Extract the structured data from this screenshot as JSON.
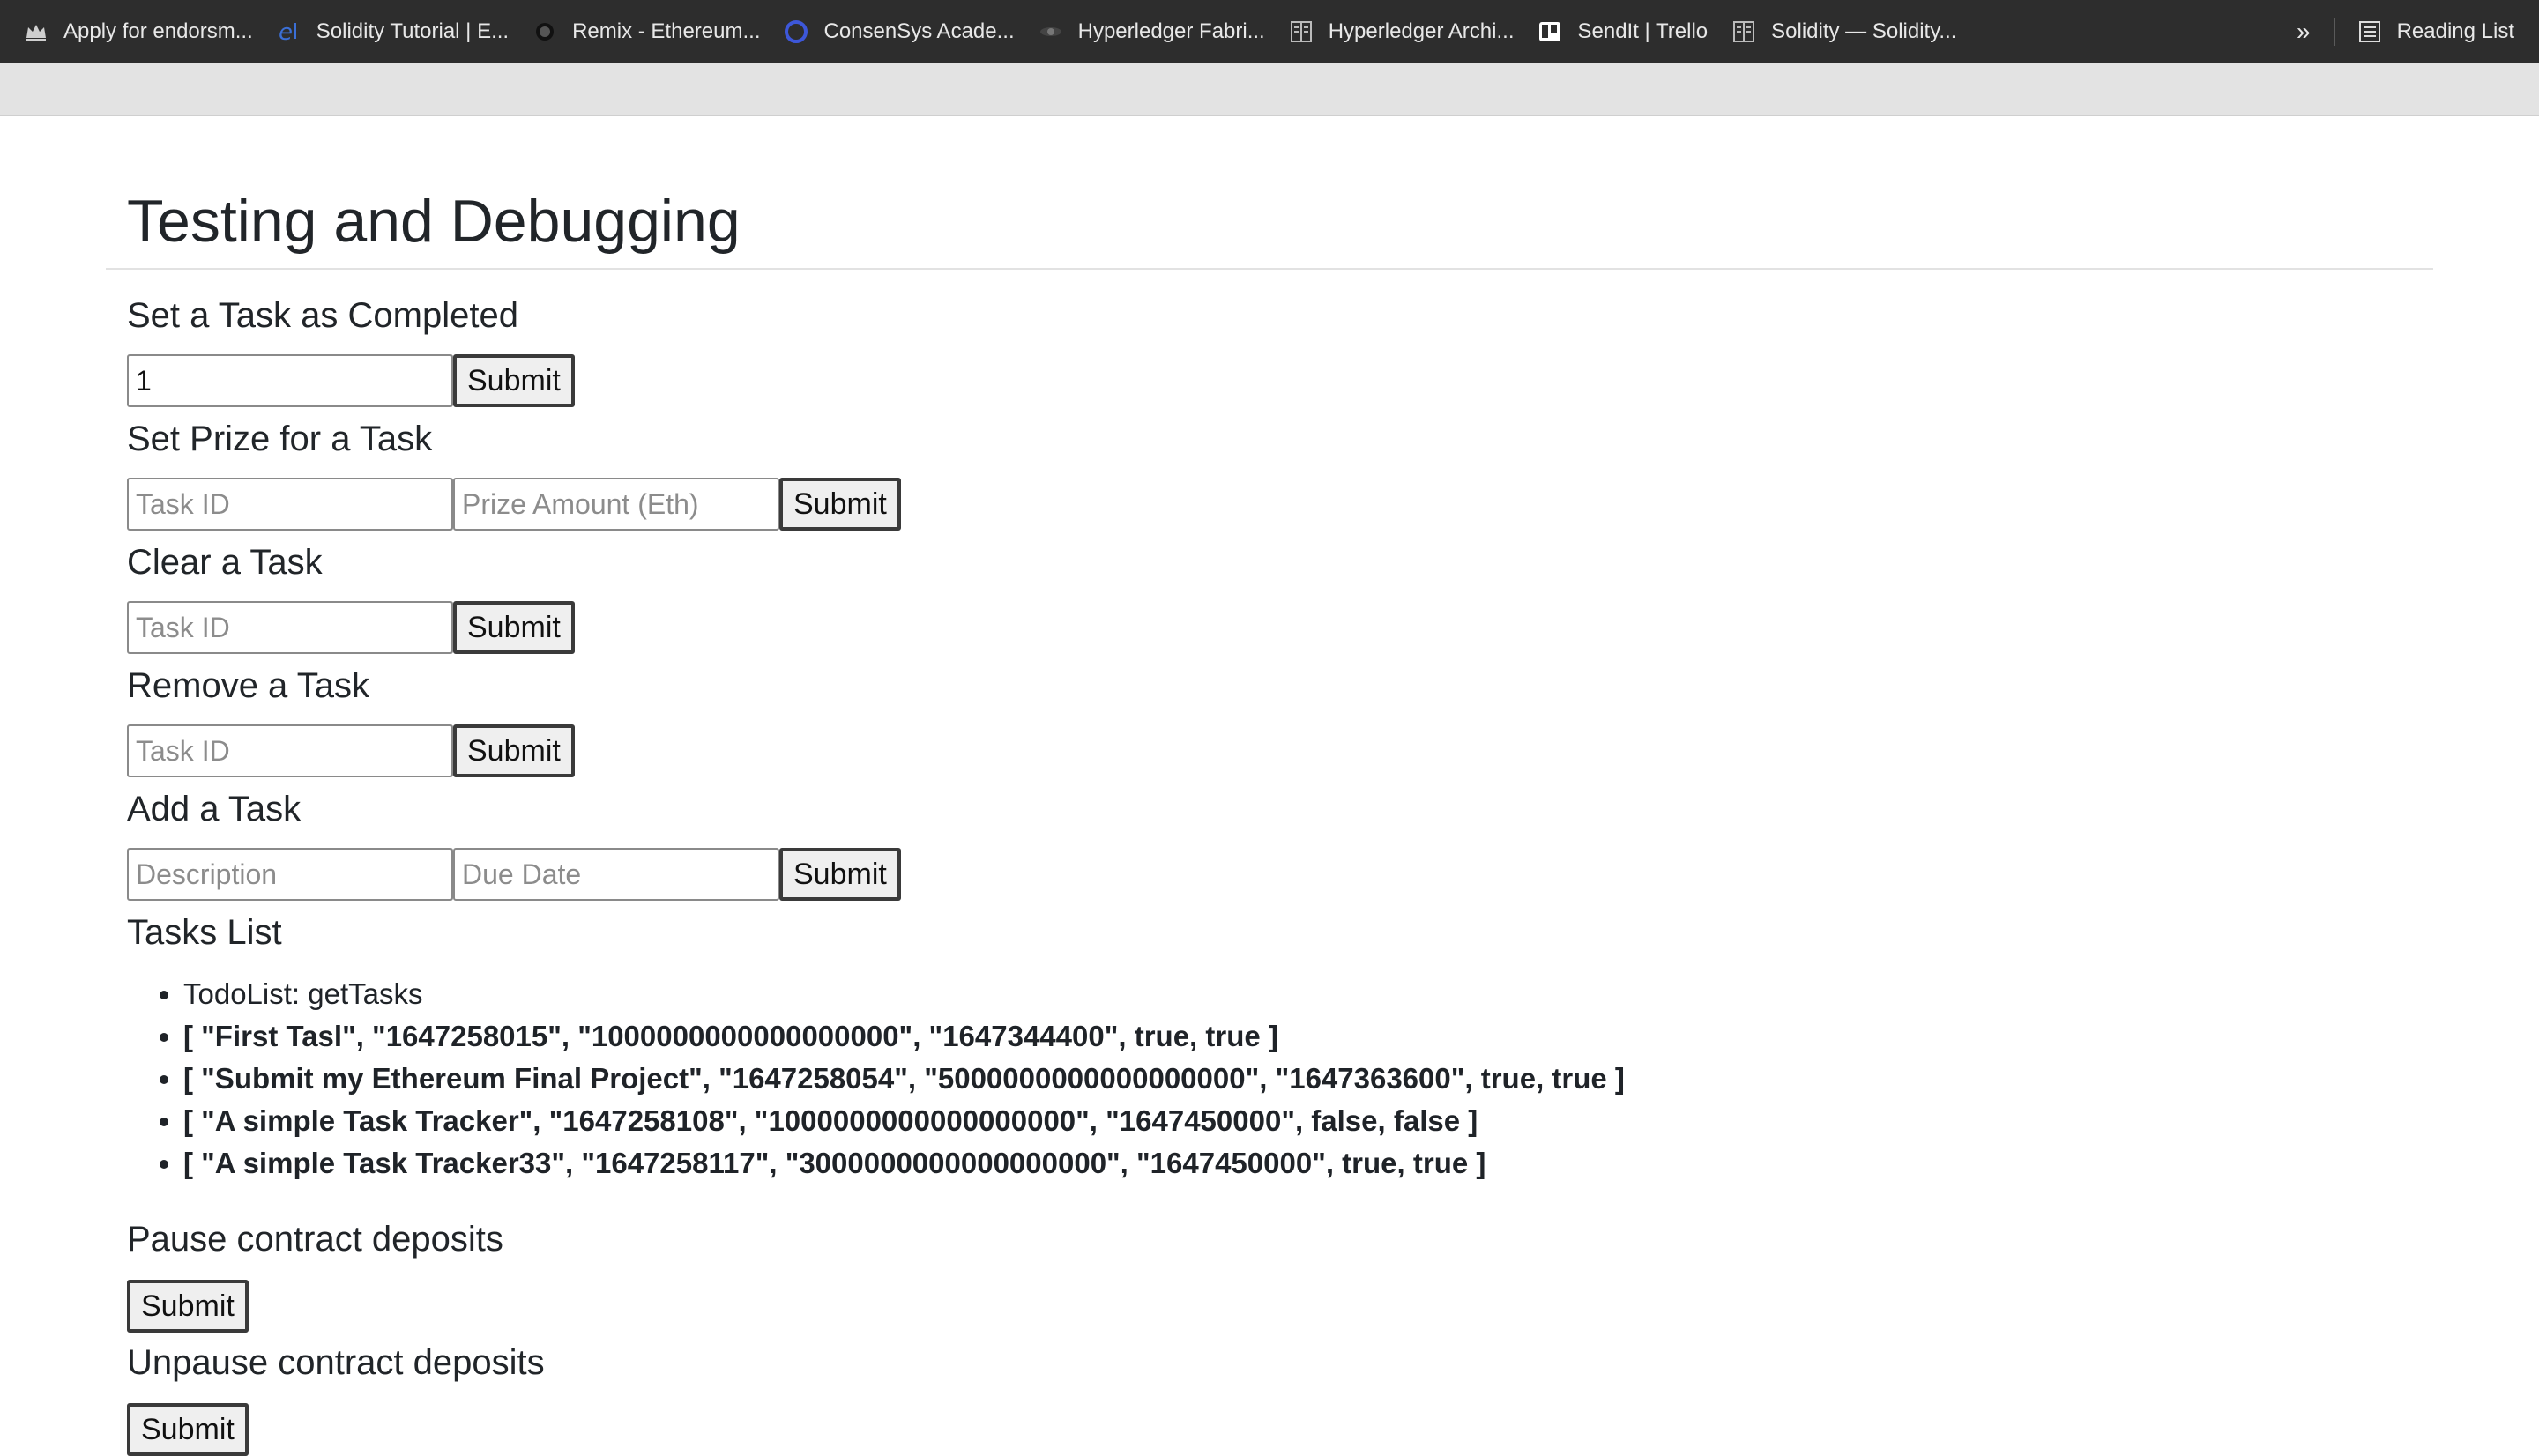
{
  "bookmarks": [
    {
      "icon": "crown-icon",
      "label": "Apply for endorsm..."
    },
    {
      "icon": "e-logo-icon",
      "label": "Solidity Tutorial | E..."
    },
    {
      "icon": "remix-icon",
      "label": "Remix - Ethereum..."
    },
    {
      "icon": "consensys-icon",
      "label": "ConsenSys Acade..."
    },
    {
      "icon": "hyperledger-icon",
      "label": "Hyperledger Fabri..."
    },
    {
      "icon": "docs-icon",
      "label": "Hyperledger Archi..."
    },
    {
      "icon": "trello-icon",
      "label": "SendIt | Trello"
    },
    {
      "icon": "docs-icon",
      "label": "Solidity — Solidity..."
    }
  ],
  "bookmarks_more": "»",
  "reading_list": "Reading List",
  "page": {
    "title": "Testing and Debugging",
    "set_completed": {
      "heading": "Set a Task as Completed",
      "value": "1",
      "submit": "Submit"
    },
    "set_prize": {
      "heading": "Set Prize for a Task",
      "task_placeholder": "Task ID",
      "amount_placeholder": "Prize Amount (Eth)",
      "submit": "Submit"
    },
    "clear_task": {
      "heading": "Clear a Task",
      "task_placeholder": "Task ID",
      "submit": "Submit"
    },
    "remove_task": {
      "heading": "Remove a Task",
      "task_placeholder": "Task ID",
      "submit": "Submit"
    },
    "add_task": {
      "heading": "Add a Task",
      "desc_placeholder": "Description",
      "due_placeholder": "Due Date",
      "submit": "Submit"
    },
    "tasks_list": {
      "heading": "Tasks List",
      "items": [
        "TodoList: getTasks",
        "[ \"First Tasl\", \"1647258015\", \"1000000000000000000\", \"1647344400\", true, true ]",
        "[ \"Submit my Ethereum Final Project\", \"1647258054\", \"5000000000000000000\", \"1647363600\", true, true ]",
        "[ \"A simple Task Tracker\", \"1647258108\", \"1000000000000000000\", \"1647450000\", false, false ]",
        "[ \"A simple Task Tracker33\", \"1647258117\", \"3000000000000000000\", \"1647450000\", true, true ]"
      ]
    },
    "pause": {
      "heading": "Pause contract deposits",
      "submit": "Submit"
    },
    "unpause": {
      "heading": "Unpause contract deposits",
      "submit": "Submit"
    }
  }
}
